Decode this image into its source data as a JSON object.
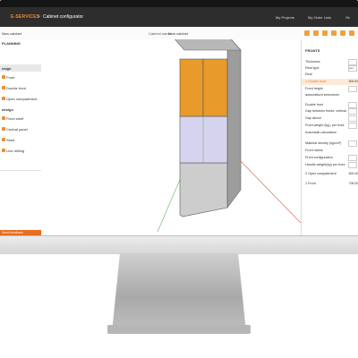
{
  "app": {
    "brand": "E-SERVICES",
    "separator": ">",
    "title": "Cabinet configurator",
    "nav": [
      "My Projects",
      "My Order Lists",
      "Se"
    ]
  },
  "toolbar": {
    "left_label": "New cabinet",
    "cabinet_name_label": "Cabinet name",
    "cabinet_name_value": "New cabinet"
  },
  "left_panel": {
    "header": "PLANNING",
    "section1": "esign",
    "items1": [
      {
        "label": "Front"
      },
      {
        "label": "Double front"
      },
      {
        "label": "Open compartment"
      }
    ],
    "section2": "design",
    "items2": [
      {
        "label": "Fixed shelf"
      },
      {
        "label": "Central panel"
      },
      {
        "label": "Shelf"
      },
      {
        "label": "Line drilling"
      }
    ],
    "feedback": "Send feedback"
  },
  "right_panel": {
    "header": "FRONTS",
    "rows": [
      {
        "label": "Thickness"
      },
      {
        "label": "Real type",
        "value": "cen"
      },
      {
        "label": "Real"
      }
    ],
    "double_front": {
      "label": "1 Double front",
      "value": "600.00"
    },
    "rows2": [
      {
        "label": "Front height"
      },
      {
        "label": "automatisch berechnen"
      },
      {
        "label": "Double front"
      },
      {
        "label": "Gap between fronts, vertical"
      },
      {
        "label": "Gap above"
      },
      {
        "label": "Front weight (kg), per front"
      },
      {
        "label": "Automatic calculation"
      },
      {
        "label": "Material density (kg/cm³)"
      },
      {
        "label": "Front radius"
      },
      {
        "label": "Front configuration"
      },
      {
        "label": "Handle weight(kg) per front"
      }
    ],
    "open_compartment": {
      "label": "2 Open compartment",
      "value": "600.00"
    },
    "front": {
      "label": "1 Front",
      "value": "708.00"
    }
  },
  "colors": {
    "accent": "#e8741e",
    "front_orange": "#e89a2a",
    "middle_lavender": "#d6d3ee",
    "bottom_gray": "#cdcdcd",
    "topbar": "#2d2d2d"
  }
}
